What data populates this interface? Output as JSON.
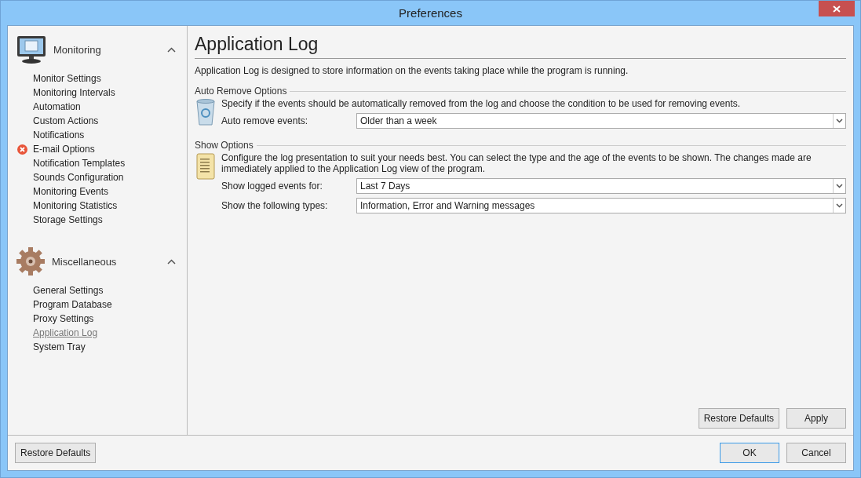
{
  "window": {
    "title": "Preferences"
  },
  "sidebar": {
    "groups": [
      {
        "title": "Monitoring",
        "kind": "monitor",
        "expanded": true,
        "items": [
          {
            "label": "Monitor Settings",
            "selected": false,
            "error": false
          },
          {
            "label": "Monitoring Intervals",
            "selected": false,
            "error": false
          },
          {
            "label": "Automation",
            "selected": false,
            "error": false
          },
          {
            "label": "Custom Actions",
            "selected": false,
            "error": false
          },
          {
            "label": "Notifications",
            "selected": false,
            "error": false
          },
          {
            "label": "E-mail Options",
            "selected": false,
            "error": true
          },
          {
            "label": "Notification Templates",
            "selected": false,
            "error": false
          },
          {
            "label": "Sounds Configuration",
            "selected": false,
            "error": false
          },
          {
            "label": "Monitoring Events",
            "selected": false,
            "error": false
          },
          {
            "label": "Monitoring Statistics",
            "selected": false,
            "error": false
          },
          {
            "label": "Storage Settings",
            "selected": false,
            "error": false
          }
        ]
      },
      {
        "title": "Miscellaneous",
        "kind": "gear",
        "expanded": true,
        "items": [
          {
            "label": "General Settings",
            "selected": false,
            "error": false
          },
          {
            "label": "Program Database",
            "selected": false,
            "error": false
          },
          {
            "label": "Proxy Settings",
            "selected": false,
            "error": false
          },
          {
            "label": "Application Log",
            "selected": true,
            "error": false
          },
          {
            "label": "System Tray",
            "selected": false,
            "error": false
          }
        ]
      }
    ]
  },
  "page": {
    "title": "Application Log",
    "intro": "Application Log is designed to store information on the events taking place while the program is running.",
    "sections": [
      {
        "title": "Auto Remove Options",
        "kind": "recycle",
        "description": "Specify if the events should be automatically removed from the log and choose the condition to be used for removing events.",
        "fields": [
          {
            "label": "Auto remove events:",
            "value": "Older than a week"
          }
        ]
      },
      {
        "title": "Show Options",
        "kind": "scroll",
        "description": "Configure the log presentation to suit your needs best. You can select the type and the age of the events to be shown. The changes made are immediately applied to the Application Log view of the program.",
        "fields": [
          {
            "label": "Show logged events for:",
            "value": "Last 7 Days"
          },
          {
            "label": "Show the following types:",
            "value": "Information, Error and Warning messages"
          }
        ]
      }
    ],
    "buttons": [
      "Restore Defaults",
      "Apply"
    ]
  },
  "footer": {
    "left_button": "Restore Defaults",
    "buttons": [
      {
        "label": "OK",
        "default": true
      },
      {
        "label": "Cancel",
        "default": false
      }
    ]
  }
}
